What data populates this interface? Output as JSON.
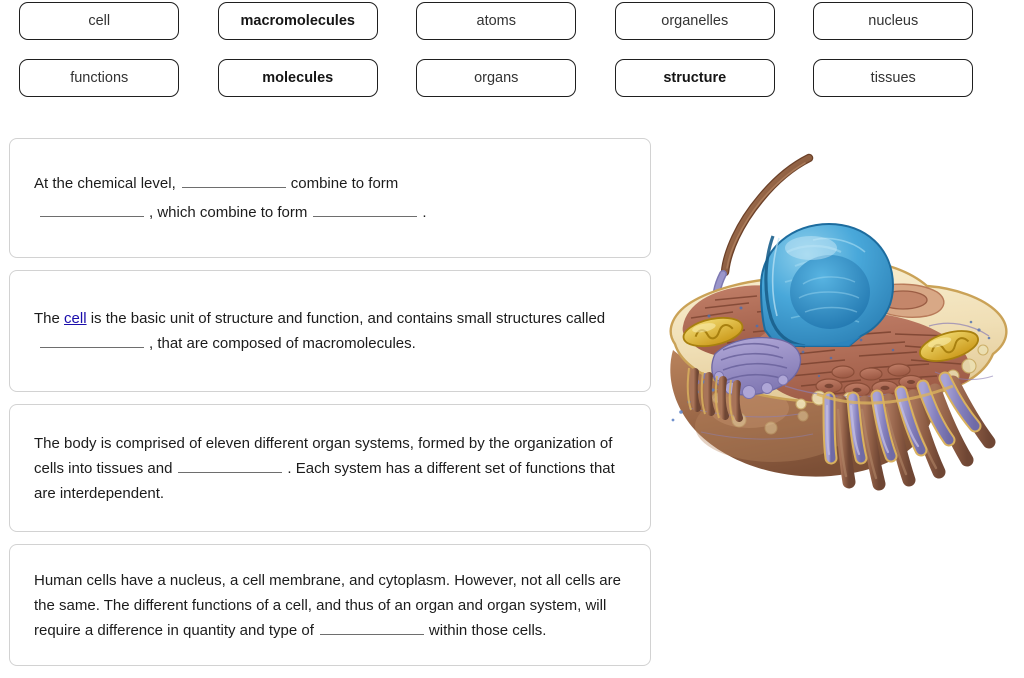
{
  "token_bank": {
    "rows": [
      [
        {
          "label": "cell",
          "bold": false
        },
        {
          "label": "macromolecules",
          "bold": true
        },
        {
          "label": "atoms",
          "bold": false
        },
        {
          "label": "organelles",
          "bold": false
        },
        {
          "label": "nucleus",
          "bold": false
        }
      ],
      [
        {
          "label": "functions",
          "bold": false
        },
        {
          "label": "molecules",
          "bold": true
        },
        {
          "label": "organs",
          "bold": false
        },
        {
          "label": "structure",
          "bold": true
        },
        {
          "label": "tissues",
          "bold": false
        }
      ]
    ]
  },
  "statements": [
    {
      "id": "stmt-0",
      "segments": [
        {
          "type": "text",
          "value": "At the chemical level,"
        },
        {
          "type": "blank"
        },
        {
          "type": "text",
          "value": "combine to form"
        },
        {
          "type": "break"
        },
        {
          "type": "blank"
        },
        {
          "type": "text",
          "value": ", which combine to form"
        },
        {
          "type": "blank"
        },
        {
          "type": "text",
          "value": "."
        }
      ]
    },
    {
      "id": "stmt-1",
      "segments": [
        {
          "type": "text",
          "value": "The"
        },
        {
          "type": "link",
          "value": "cell"
        },
        {
          "type": "text",
          "value": "is the basic unit of structure and function, and contains small structures called"
        },
        {
          "type": "blank"
        },
        {
          "type": "text",
          "value": ", that are composed of macromolecules."
        }
      ]
    },
    {
      "id": "stmt-2",
      "segments": [
        {
          "type": "text",
          "value": "The body is comprised of eleven different organ systems, formed by the organization of cells into tissues and"
        },
        {
          "type": "blank"
        },
        {
          "type": "text",
          "value": ". Each system has a different set of functions that are interdependent."
        }
      ]
    },
    {
      "id": "stmt-3",
      "segments": [
        {
          "type": "text",
          "value": "Human cells have a nucleus, a cell membrane, and cytoplasm. However, not all cells are the same. The different functions of a cell, and thus of an organ and organ system, will require a difference in quantity and type of"
        },
        {
          "type": "blank"
        },
        {
          "type": "text",
          "value": "within those cells."
        }
      ]
    }
  ],
  "figure": {
    "name": "animal-cell-cutaway-illustration",
    "parts": [
      "flagellum",
      "nucleus",
      "nucleolus",
      "nuclear-envelope",
      "rough-endoplasmic-reticulum",
      "golgi-apparatus",
      "mitochondrion-left",
      "mitochondrion-right",
      "lysosome-vesicles",
      "cytoplasm",
      "cell-membrane",
      "microvilli",
      "cilia"
    ],
    "colors": {
      "cell_body": "#9c6b4a",
      "cytoplasm": "#f2e2bd",
      "membrane": "#d9b15e",
      "nucleus": "#3fa3d8",
      "nucleolus": "#2f8ec4",
      "er": "#b5705a",
      "golgi": "#9b93c8",
      "mitochondria": "#e8c33f",
      "cilia": "#8b88c4",
      "flagellum": "#8a5a42"
    }
  }
}
